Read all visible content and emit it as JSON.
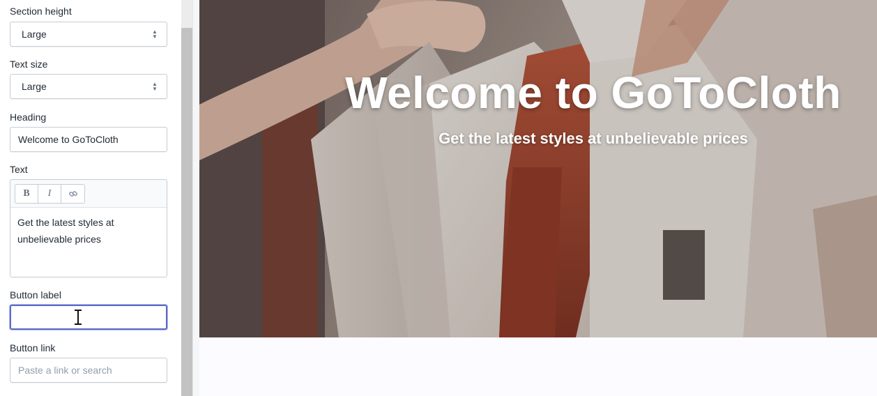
{
  "sidebar": {
    "section_height": {
      "label": "Section height",
      "value": "Large"
    },
    "text_size": {
      "label": "Text size",
      "value": "Large"
    },
    "heading": {
      "label": "Heading",
      "value": "Welcome to GoToCloth"
    },
    "text": {
      "label": "Text",
      "toolbar": {
        "bold": "B",
        "italic": "I",
        "link_icon": "link-icon"
      },
      "value": "Get the latest styles at unbelievable prices"
    },
    "button_label": {
      "label": "Button label",
      "value": ""
    },
    "button_link": {
      "label": "Button link",
      "placeholder": "Paste a link or search"
    }
  },
  "preview": {
    "heading": "Welcome to GoToCloth",
    "subheading": "Get the latest styles at unbelievable prices"
  },
  "colors": {
    "focus": "#5c6ac4",
    "text": "#212b36",
    "placeholder": "#919eab"
  }
}
